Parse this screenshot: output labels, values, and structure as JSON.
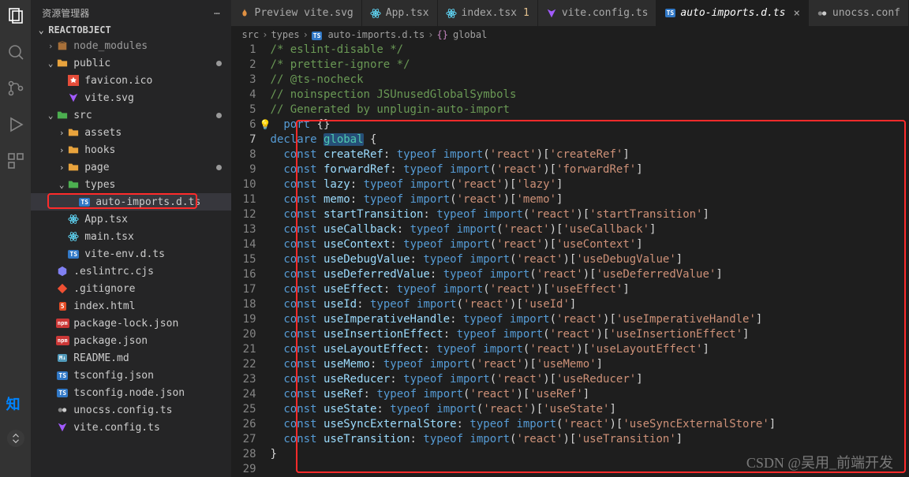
{
  "sidebar": {
    "title": "资源管理器",
    "project": "REACTOBJECT",
    "tree": [
      {
        "indent": 0,
        "chev": ">",
        "icon": "pkg",
        "iconColor": "#e09142",
        "label": "node_modules",
        "dimmed": true
      },
      {
        "indent": 0,
        "chev": "v",
        "icon": "folder",
        "iconColor": "#e8a33d",
        "label": "public",
        "dot": true
      },
      {
        "indent": 1,
        "chev": "",
        "icon": "fav",
        "iconColor": "#e54d3a",
        "label": "favicon.ico"
      },
      {
        "indent": 1,
        "chev": "",
        "icon": "vite",
        "iconColor": "#a25bff",
        "label": "vite.svg"
      },
      {
        "indent": 0,
        "chev": "v",
        "icon": "src",
        "iconColor": "#4caf50",
        "label": "src",
        "dot": true
      },
      {
        "indent": 1,
        "chev": ">",
        "icon": "folder",
        "iconColor": "#e8a33d",
        "label": "assets"
      },
      {
        "indent": 1,
        "chev": ">",
        "icon": "folder",
        "iconColor": "#e8a33d",
        "label": "hooks"
      },
      {
        "indent": 1,
        "chev": ">",
        "icon": "folder",
        "iconColor": "#e8a33d",
        "label": "page",
        "dot": true
      },
      {
        "indent": 1,
        "chev": "v",
        "icon": "folder",
        "iconColor": "#4caf50",
        "label": "types"
      },
      {
        "indent": 2,
        "chev": "",
        "icon": "ts",
        "iconColor": "#3178c6",
        "label": "auto-imports.d.ts",
        "active": true
      },
      {
        "indent": 1,
        "chev": "",
        "icon": "react",
        "iconColor": "#61dafb",
        "label": "App.tsx"
      },
      {
        "indent": 1,
        "chev": "",
        "icon": "react",
        "iconColor": "#61dafb",
        "label": "main.tsx"
      },
      {
        "indent": 1,
        "chev": "",
        "icon": "ts",
        "iconColor": "#3178c6",
        "label": "vite-env.d.ts"
      },
      {
        "indent": 0,
        "chev": "",
        "icon": "eslint",
        "iconColor": "#8080f2",
        "label": ".eslintrc.cjs"
      },
      {
        "indent": 0,
        "chev": "",
        "icon": "git",
        "iconColor": "#f05033",
        "label": ".gitignore"
      },
      {
        "indent": 0,
        "chev": "",
        "icon": "html",
        "iconColor": "#e44d26",
        "label": "index.html"
      },
      {
        "indent": 0,
        "chev": "",
        "icon": "npm",
        "iconColor": "#cb3837",
        "label": "package-lock.json"
      },
      {
        "indent": 0,
        "chev": "",
        "icon": "npm",
        "iconColor": "#cb3837",
        "label": "package.json"
      },
      {
        "indent": 0,
        "chev": "",
        "icon": "md",
        "iconColor": "#519aba",
        "label": "README.md"
      },
      {
        "indent": 0,
        "chev": "",
        "icon": "ts",
        "iconColor": "#3178c6",
        "label": "tsconfig.json"
      },
      {
        "indent": 0,
        "chev": "",
        "icon": "ts",
        "iconColor": "#3178c6",
        "label": "tsconfig.node.json"
      },
      {
        "indent": 0,
        "chev": "",
        "icon": "uno",
        "iconColor": "#ccc",
        "label": "unocss.config.ts"
      },
      {
        "indent": 0,
        "chev": "",
        "icon": "vite",
        "iconColor": "#a25bff",
        "label": "vite.config.ts"
      }
    ]
  },
  "tabs": [
    {
      "icon": "flame",
      "iconColor": "#e09142",
      "label": "Preview vite.svg"
    },
    {
      "icon": "react",
      "iconColor": "#61dafb",
      "label": "App.tsx"
    },
    {
      "icon": "react",
      "iconColor": "#61dafb",
      "label": "index.tsx",
      "modified": "1"
    },
    {
      "icon": "vite",
      "iconColor": "#a25bff",
      "label": "vite.config.ts"
    },
    {
      "icon": "ts",
      "iconColor": "#3178c6",
      "label": "auto-imports.d.ts",
      "active": true,
      "close": "×"
    },
    {
      "icon": "uno",
      "iconColor": "#ccc",
      "label": "unocss.conf"
    }
  ],
  "breadcrumb": [
    "src",
    "types",
    "auto-imports.d.ts",
    "global"
  ],
  "code": {
    "comments": [
      "/* eslint-disable */",
      "/* prettier-ignore */",
      "// @ts-nocheck",
      "// noinspection JSUnusedGlobalSymbols",
      "// Generated by unplugin-auto-import"
    ],
    "exportLine": "export {}",
    "declare": "declare",
    "global": "global",
    "decls": [
      {
        "name": "createRef",
        "key": "createRef"
      },
      {
        "name": "forwardRef",
        "key": "forwardRef"
      },
      {
        "name": "lazy",
        "key": "lazy"
      },
      {
        "name": "memo",
        "key": "memo"
      },
      {
        "name": "startTransition",
        "key": "startTransition"
      },
      {
        "name": "useCallback",
        "key": "useCallback"
      },
      {
        "name": "useContext",
        "key": "useContext"
      },
      {
        "name": "useDebugValue",
        "key": "useDebugValue"
      },
      {
        "name": "useDeferredValue",
        "key": "useDeferredValue"
      },
      {
        "name": "useEffect",
        "key": "useEffect"
      },
      {
        "name": "useId",
        "key": "useId"
      },
      {
        "name": "useImperativeHandle",
        "key": "useImperativeHandle"
      },
      {
        "name": "useInsertionEffect",
        "key": "useInsertionEffect"
      },
      {
        "name": "useLayoutEffect",
        "key": "useLayoutEffect"
      },
      {
        "name": "useMemo",
        "key": "useMemo"
      },
      {
        "name": "useReducer",
        "key": "useReducer"
      },
      {
        "name": "useRef",
        "key": "useRef"
      },
      {
        "name": "useState",
        "key": "useState"
      },
      {
        "name": "useSyncExternalStore",
        "key": "useSyncExternalStore"
      },
      {
        "name": "useTransition",
        "key": "useTransition"
      }
    ]
  },
  "watermark": "CSDN @吴用_前端开发"
}
